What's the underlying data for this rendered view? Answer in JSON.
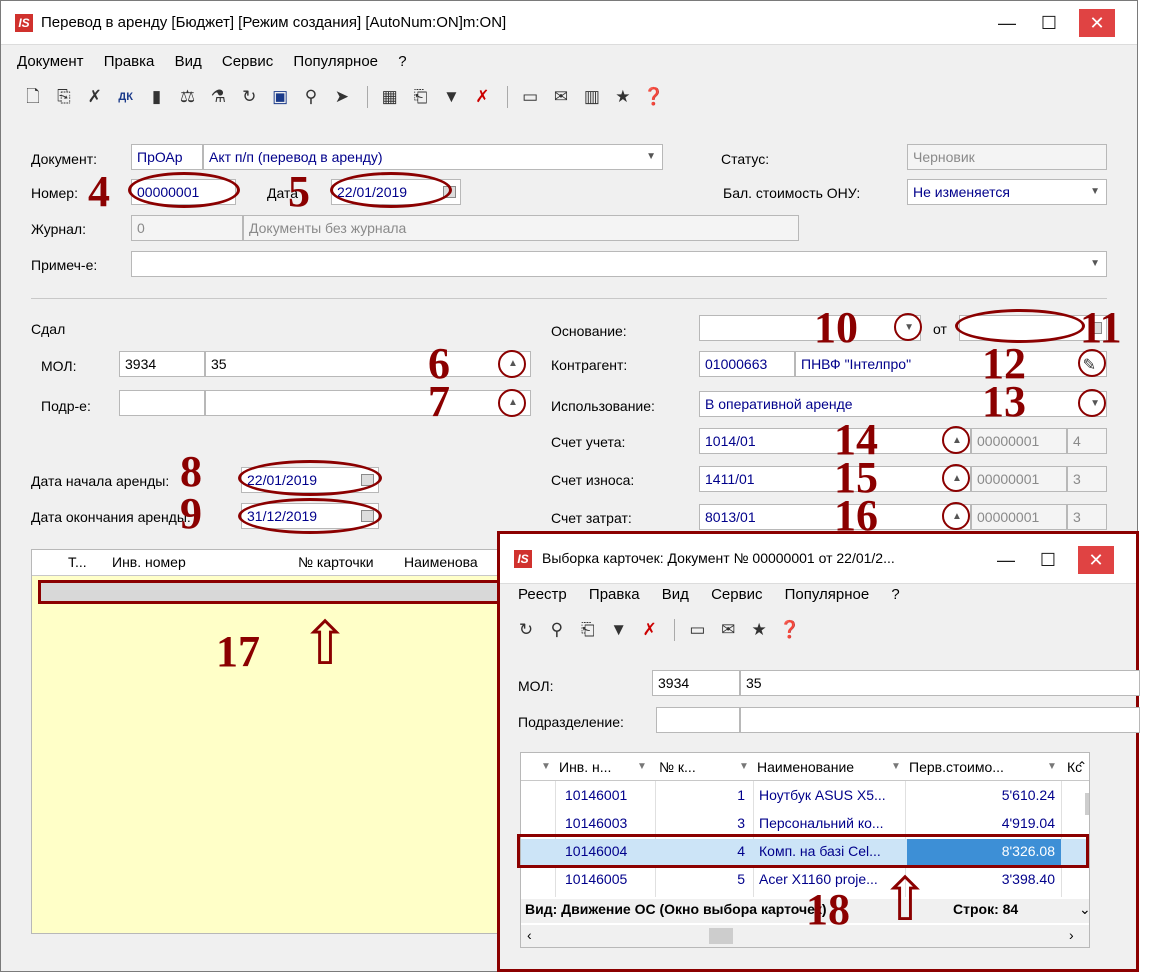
{
  "main": {
    "title": "Перевод в аренду [Бюджет] [Режим создания] [AutoNum:ON]m:ON]",
    "logo": "IS",
    "menu": [
      "Документ",
      "Правка",
      "Вид",
      "Сервис",
      "Популярное",
      "?"
    ],
    "toolbar_icons": [
      "new-doc-icon",
      "copy-doc-icon",
      "delete-doc-icon",
      "dk-icon",
      "post-icon",
      "tax-icon",
      "balance-icon",
      "refresh-icon",
      "save-icon",
      "find-icon",
      "filter-nav-icon",
      "grid-icon",
      "export-icon",
      "filter-icon",
      "clear-filter-icon",
      "form-icon",
      "mail-icon",
      "barcode-icon",
      "favorite-icon",
      "help-icon"
    ]
  },
  "form": {
    "document_label": "Документ:",
    "document_code": "ПрОАр",
    "document_name": "Акт п/п (перевод в аренду)",
    "status_label": "Статус:",
    "status_value": "Черновик",
    "number_label": "Номер:",
    "number_value": "00000001",
    "date_label": "Дата",
    "date_value": "22/01/2019",
    "bal_label": "Бал. стоимость ОНУ:",
    "bal_value": "Не изменяется",
    "journal_label": "Журнал:",
    "journal_code": "0",
    "journal_name": "Документы без журнала",
    "note_label": "Примеч-е:",
    "gave_label": "Сдал",
    "mol_label": "МОЛ:",
    "mol_code": "3934",
    "mol_name": "35",
    "dept_label": "Подр-е:",
    "start_label": "Дата начала аренды:",
    "start_value": "22/01/2019",
    "end_label": "Дата окончания аренды:",
    "end_value": "31/12/2019",
    "basis_label": "Основание:",
    "basis_from": "от",
    "counterparty_label": "Контрагент:",
    "counterparty_code": "01000663",
    "counterparty_name": "ПНВФ \"Інтелпро\"",
    "usage_label": "Использование:",
    "usage_value": "В оперативной аренде",
    "acc_label": "Счет учета:",
    "acc_value": "1014/01",
    "acc_sub": "00000001",
    "acc_n": "4",
    "wear_label": "Счет износа:",
    "wear_value": "1411/01",
    "wear_sub": "00000001",
    "wear_n": "3",
    "cost_label": "Счет затрат:",
    "cost_value": "8013/01",
    "cost_sub": "00000001",
    "cost_n": "3"
  },
  "grid": {
    "columns": [
      "Т...",
      "Инв. номер",
      "№ карточки",
      "Наименова"
    ]
  },
  "annotations": [
    "4",
    "5",
    "6",
    "7",
    "8",
    "9",
    "10",
    "11",
    "12",
    "13",
    "14",
    "15",
    "16",
    "17",
    "18"
  ],
  "dialog": {
    "title": "Выборка карточек: Документ № 00000001 от 22/01/2...",
    "menu": [
      "Реестр",
      "Правка",
      "Вид",
      "Сервис",
      "Популярное",
      "?"
    ],
    "toolbar_icons": [
      "refresh-icon",
      "search-icon",
      "export-icon",
      "filter-icon",
      "clear-filter-icon",
      "form-icon",
      "mail-icon",
      "favorite-icon",
      "help-icon"
    ],
    "mol_label": "МОЛ:",
    "mol_code": "3934",
    "mol_name": "35",
    "dept_label": "Подразделение:",
    "columns": [
      "Инв. н...",
      "№ к...",
      "Наименование",
      "Перв.стоимо...",
      "Кс"
    ],
    "rows": [
      {
        "inv": "10146001",
        "num": "1",
        "name": "Ноутбук ASUS X5...",
        "cost": "5'610.24"
      },
      {
        "inv": "10146003",
        "num": "3",
        "name": "Персональний ко...",
        "cost": "4'919.04"
      },
      {
        "inv": "10146004",
        "num": "4",
        "name": "Комп. на базі Cel...",
        "cost": "8'326.08"
      },
      {
        "inv": "10146005",
        "num": "5",
        "name": "Acer X1160 proje...",
        "cost": "3'398.40"
      }
    ],
    "footer_view": "Вид: Движение ОС (Окно выбора карточек)",
    "footer_rows": "Строк: 84"
  }
}
